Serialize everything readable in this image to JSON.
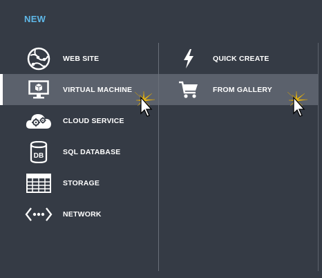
{
  "header": {
    "title": "NEW"
  },
  "left_menu": {
    "items": [
      {
        "label": "WEB SITE",
        "icon": "globe-icon"
      },
      {
        "label": "VIRTUAL MACHINE",
        "icon": "monitor-icon",
        "selected": true
      },
      {
        "label": "CLOUD SERVICE",
        "icon": "cloud-gears-icon"
      },
      {
        "label": "SQL DATABASE",
        "icon": "database-icon"
      },
      {
        "label": "STORAGE",
        "icon": "table-grid-icon"
      },
      {
        "label": "NETWORK",
        "icon": "network-icon"
      }
    ]
  },
  "right_menu": {
    "items": [
      {
        "label": "QUICK CREATE",
        "icon": "lightning-icon"
      },
      {
        "label": "FROM GALLERY",
        "icon": "cart-icon",
        "selected": true
      }
    ]
  },
  "colors": {
    "background": "#353b45",
    "selected": "#5b616c",
    "accent": "#5fb8e8",
    "text": "#ffffff"
  }
}
